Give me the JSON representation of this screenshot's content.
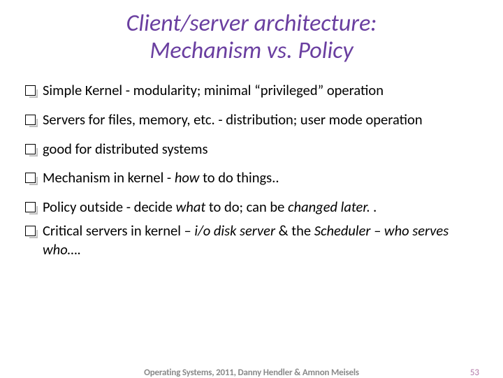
{
  "title": {
    "line1": "Client/server architecture:",
    "line2": "Mechanism vs. Policy"
  },
  "bullets": {
    "b1": "Simple Kernel - modularity; minimal “privileged” operation",
    "b2": "Servers for files, memory, etc. - distribution; user mode operation",
    "b3": "good for distributed systems",
    "b4_pre": "Mechanism in kernel - ",
    "b4_em": "how",
    "b4_post": " to do things..",
    "b5_pre": "Policy outside - decide ",
    "b5_em1": "what",
    "b5_mid": " to do; can be ",
    "b5_em2": "changed later. .",
    "b6_pre": "Critical servers in kernel – ",
    "b6_em1": "i/o disk server",
    "b6_mid": " & the ",
    "b6_em2": "Scheduler – who serves who…."
  },
  "footer": {
    "text": "Operating Systems, 2011, Danny Hendler & Amnon Meisels",
    "page": "53"
  }
}
